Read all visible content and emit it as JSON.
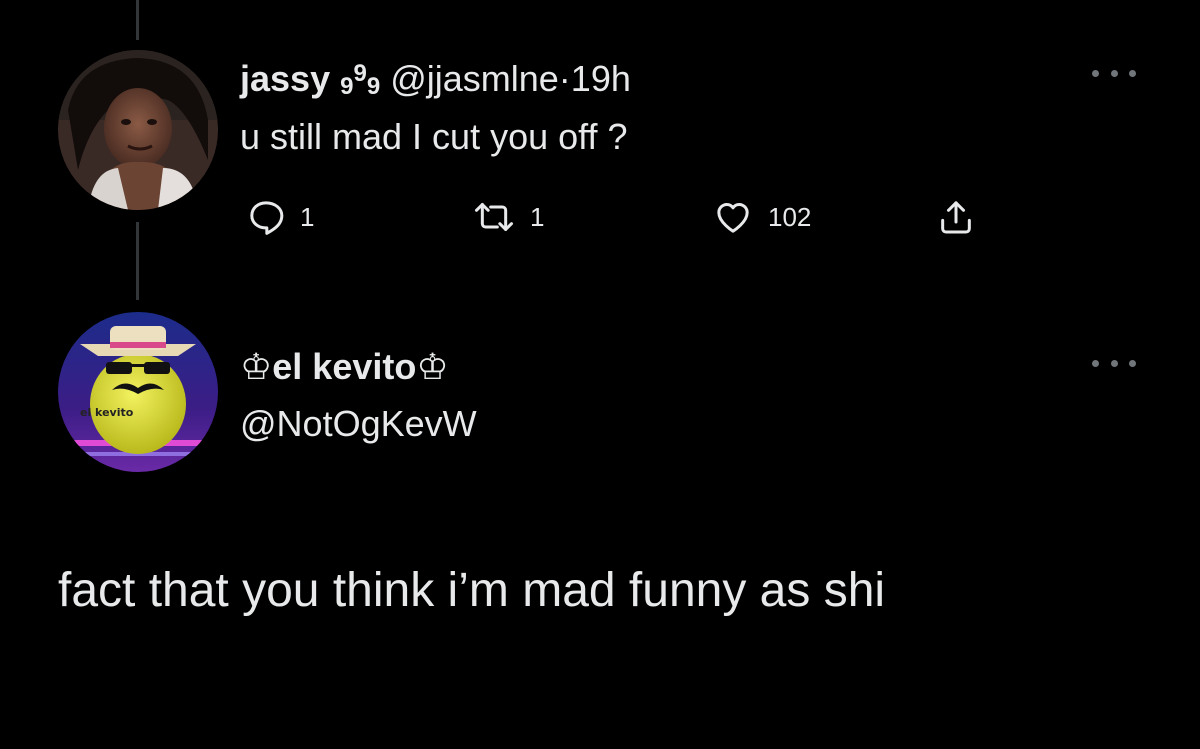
{
  "tweet": {
    "author": {
      "name": "jassy",
      "name_sub_1": "9",
      "name_sup": "9",
      "name_sub_2": "9",
      "handle": "@jjasmlne",
      "separator": "·",
      "time": "19h"
    },
    "text": "u still mad I cut you off ?",
    "stats": {
      "replies": "1",
      "retweets": "1",
      "likes": "102"
    }
  },
  "reply": {
    "author": {
      "name": "♔el kevito♔",
      "handle": "@NotOgKevW"
    },
    "avatar_label": "el kevito",
    "text": "fact that you think i’m mad funny as shi"
  },
  "icons": {
    "more": "more-horizontal-icon",
    "reply": "reply-icon",
    "retweet": "retweet-icon",
    "like": "heart-icon",
    "share": "share-icon"
  },
  "colors": {
    "background": "#000000",
    "text": "#e7e9ea",
    "icon": "#71767b",
    "thread_line": "#333639"
  }
}
